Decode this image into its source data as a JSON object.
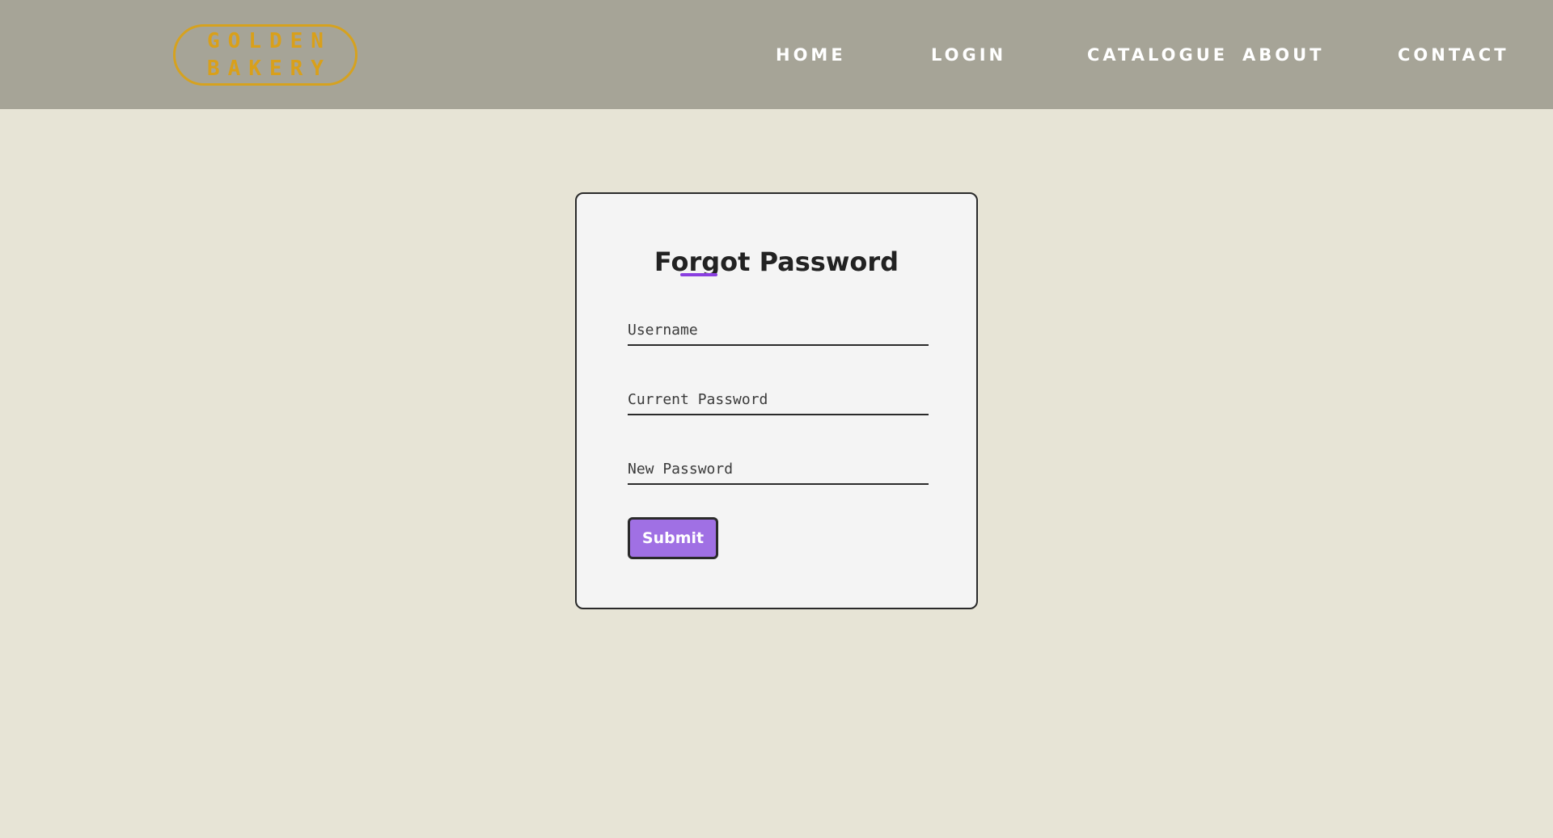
{
  "header": {
    "logo": {
      "line1": "GOLDEN",
      "line2": "BAKERY"
    },
    "nav": {
      "home": "HOME",
      "login": "LOGIN",
      "catalogue": "CATALOGUE",
      "about": "ABOUT",
      "contact": "CONTACT"
    }
  },
  "form": {
    "title": "Forgot Password",
    "username_placeholder": "Username",
    "username_value": "",
    "current_password_placeholder": "Current Password",
    "current_password_value": "",
    "new_password_placeholder": "New Password",
    "new_password_value": "",
    "submit_label": "Submit"
  },
  "colors": {
    "navbar_bg": "#a6a497",
    "page_bg": "#e7e4d6",
    "logo_gold": "#d9a01a",
    "accent_purple": "#a070e4",
    "card_bg": "#f4f4f4"
  }
}
